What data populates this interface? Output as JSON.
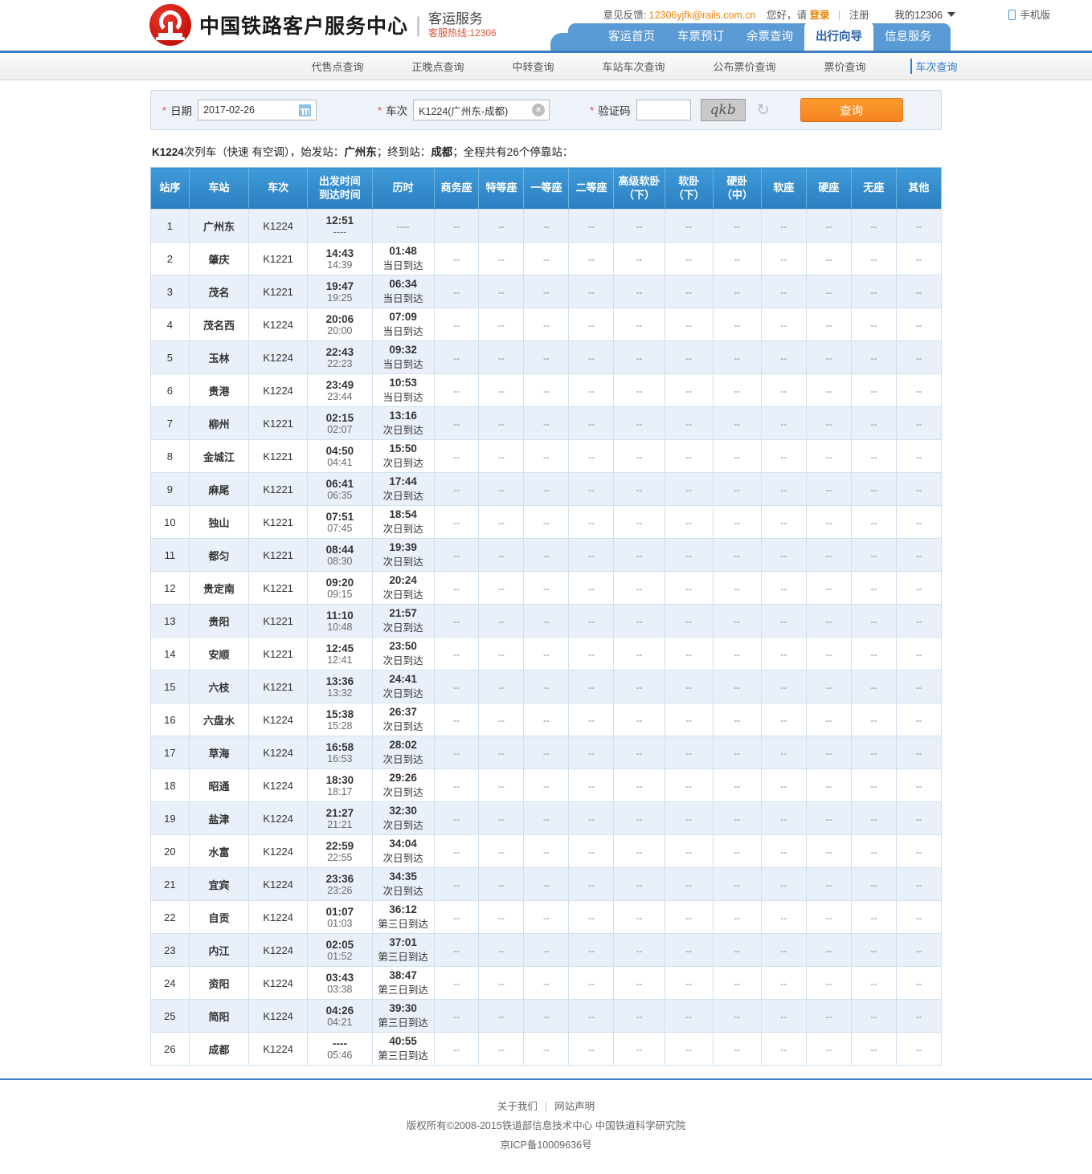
{
  "header": {
    "brand_cn": "中国铁路客户服务中心",
    "brand_sub_1": "客运服务",
    "brand_sub_2": "客服热线:12306",
    "logo_name": "china-railway-logo",
    "feedback_label": "意见反馈:",
    "feedback_mail": "12306yjfk@rails.com.cn",
    "greeting": "您好，请",
    "login": "登录",
    "divider": "|",
    "register": "注册",
    "my12306": "我的12306",
    "mobile": "手机版"
  },
  "mainnav": [
    {
      "label": "客运首页",
      "active": false
    },
    {
      "label": "车票预订",
      "active": false
    },
    {
      "label": "余票查询",
      "active": false
    },
    {
      "label": "出行向导",
      "active": true
    },
    {
      "label": "信息服务",
      "active": false
    }
  ],
  "subnav": [
    {
      "label": "代售点查询",
      "active": false
    },
    {
      "label": "正晚点查询",
      "active": false
    },
    {
      "label": "中转查询",
      "active": false
    },
    {
      "label": "车站车次查询",
      "active": false
    },
    {
      "label": "公布票价查询",
      "active": false
    },
    {
      "label": "票价查询",
      "active": false
    },
    {
      "label": "车次查询",
      "active": true
    }
  ],
  "search": {
    "required_mark": "*",
    "date_label": "日期",
    "date_value": "2017-02-26",
    "train_label": "车次",
    "train_value": "K1224(广州东-成都)",
    "code_label": "验证码",
    "code_value": "",
    "captcha_text": "qkb",
    "refresh_icon": "refresh-icon",
    "query_button": "查询"
  },
  "summary": {
    "prefix": "K1224",
    "text": "次列车（快速 有空调），始发站：",
    "from": "广州东",
    "mid": "；终到站：",
    "to": "成都",
    "suffix": "；全程共有26个停靠站："
  },
  "table": {
    "headers": [
      "站序",
      "车站",
      "车次",
      "出发时间\n到达时间",
      "历时",
      "商务座",
      "特等座",
      "一等座",
      "二等座",
      "高级软卧\n（下）",
      "软卧\n（下）",
      "硬卧\n（中）",
      "软座",
      "硬座",
      "无座",
      "其他"
    ],
    "header_parts": [
      {
        "l1": "站序",
        "l2": ""
      },
      {
        "l1": "车站",
        "l2": ""
      },
      {
        "l1": "车次",
        "l2": ""
      },
      {
        "l1": "出发时间",
        "l2": "到达时间"
      },
      {
        "l1": "历时",
        "l2": ""
      },
      {
        "l1": "商务座",
        "l2": ""
      },
      {
        "l1": "特等座",
        "l2": ""
      },
      {
        "l1": "一等座",
        "l2": ""
      },
      {
        "l1": "二等座",
        "l2": ""
      },
      {
        "l1": "高级软卧",
        "l2": "（下）"
      },
      {
        "l1": "软卧",
        "l2": "（下）"
      },
      {
        "l1": "硬卧",
        "l2": "（中）"
      },
      {
        "l1": "软座",
        "l2": ""
      },
      {
        "l1": "硬座",
        "l2": ""
      },
      {
        "l1": "无座",
        "l2": ""
      },
      {
        "l1": "其他",
        "l2": ""
      }
    ],
    "empty_cell": "--",
    "rows": [
      {
        "no": "1",
        "station": "广州东",
        "train": "K1224",
        "dep": "12:51",
        "arr": "----",
        "dur": "----",
        "day": ""
      },
      {
        "no": "2",
        "station": "肇庆",
        "train": "K1221",
        "dep": "14:43",
        "arr": "14:39",
        "dur": "01:48",
        "day": "当日到达"
      },
      {
        "no": "3",
        "station": "茂名",
        "train": "K1221",
        "dep": "19:47",
        "arr": "19:25",
        "dur": "06:34",
        "day": "当日到达"
      },
      {
        "no": "4",
        "station": "茂名西",
        "train": "K1224",
        "dep": "20:06",
        "arr": "20:00",
        "dur": "07:09",
        "day": "当日到达"
      },
      {
        "no": "5",
        "station": "玉林",
        "train": "K1224",
        "dep": "22:43",
        "arr": "22:23",
        "dur": "09:32",
        "day": "当日到达"
      },
      {
        "no": "6",
        "station": "贵港",
        "train": "K1224",
        "dep": "23:49",
        "arr": "23:44",
        "dur": "10:53",
        "day": "当日到达"
      },
      {
        "no": "7",
        "station": "柳州",
        "train": "K1221",
        "dep": "02:15",
        "arr": "02:07",
        "dur": "13:16",
        "day": "次日到达"
      },
      {
        "no": "8",
        "station": "金城江",
        "train": "K1221",
        "dep": "04:50",
        "arr": "04:41",
        "dur": "15:50",
        "day": "次日到达"
      },
      {
        "no": "9",
        "station": "麻尾",
        "train": "K1221",
        "dep": "06:41",
        "arr": "06:35",
        "dur": "17:44",
        "day": "次日到达"
      },
      {
        "no": "10",
        "station": "独山",
        "train": "K1221",
        "dep": "07:51",
        "arr": "07:45",
        "dur": "18:54",
        "day": "次日到达"
      },
      {
        "no": "11",
        "station": "都匀",
        "train": "K1221",
        "dep": "08:44",
        "arr": "08:30",
        "dur": "19:39",
        "day": "次日到达"
      },
      {
        "no": "12",
        "station": "贵定南",
        "train": "K1221",
        "dep": "09:20",
        "arr": "09:15",
        "dur": "20:24",
        "day": "次日到达"
      },
      {
        "no": "13",
        "station": "贵阳",
        "train": "K1221",
        "dep": "11:10",
        "arr": "10:48",
        "dur": "21:57",
        "day": "次日到达"
      },
      {
        "no": "14",
        "station": "安顺",
        "train": "K1221",
        "dep": "12:45",
        "arr": "12:41",
        "dur": "23:50",
        "day": "次日到达"
      },
      {
        "no": "15",
        "station": "六枝",
        "train": "K1221",
        "dep": "13:36",
        "arr": "13:32",
        "dur": "24:41",
        "day": "次日到达"
      },
      {
        "no": "16",
        "station": "六盘水",
        "train": "K1224",
        "dep": "15:38",
        "arr": "15:28",
        "dur": "26:37",
        "day": "次日到达"
      },
      {
        "no": "17",
        "station": "草海",
        "train": "K1224",
        "dep": "16:58",
        "arr": "16:53",
        "dur": "28:02",
        "day": "次日到达"
      },
      {
        "no": "18",
        "station": "昭通",
        "train": "K1224",
        "dep": "18:30",
        "arr": "18:17",
        "dur": "29:26",
        "day": "次日到达"
      },
      {
        "no": "19",
        "station": "盐津",
        "train": "K1224",
        "dep": "21:27",
        "arr": "21:21",
        "dur": "32:30",
        "day": "次日到达"
      },
      {
        "no": "20",
        "station": "水富",
        "train": "K1224",
        "dep": "22:59",
        "arr": "22:55",
        "dur": "34:04",
        "day": "次日到达"
      },
      {
        "no": "21",
        "station": "宜宾",
        "train": "K1224",
        "dep": "23:36",
        "arr": "23:26",
        "dur": "34:35",
        "day": "次日到达"
      },
      {
        "no": "22",
        "station": "自贡",
        "train": "K1224",
        "dep": "01:07",
        "arr": "01:03",
        "dur": "36:12",
        "day": "第三日到达"
      },
      {
        "no": "23",
        "station": "内江",
        "train": "K1224",
        "dep": "02:05",
        "arr": "01:52",
        "dur": "37:01",
        "day": "第三日到达"
      },
      {
        "no": "24",
        "station": "资阳",
        "train": "K1224",
        "dep": "03:43",
        "arr": "03:38",
        "dur": "38:47",
        "day": "第三日到达"
      },
      {
        "no": "25",
        "station": "简阳",
        "train": "K1224",
        "dep": "04:26",
        "arr": "04:21",
        "dur": "39:30",
        "day": "第三日到达"
      },
      {
        "no": "26",
        "station": "成都",
        "train": "K1224",
        "dep": "----",
        "arr": "05:46",
        "dur": "40:55",
        "day": "第三日到达"
      }
    ]
  },
  "footer": {
    "about": "关于我们",
    "bar": "|",
    "statement": "网站声明",
    "copyright": "版权所有©2008-2015铁道部信息技术中心  中国铁道科学研究院",
    "icp": "京ICP备10009636号"
  },
  "colors": {
    "brand_red": "#d01a12",
    "nav_blue": "#5b9bd5",
    "table_header_blue": "#2b7fc0",
    "accent_orange": "#f58220",
    "row_odd": "#eaf0fa"
  }
}
